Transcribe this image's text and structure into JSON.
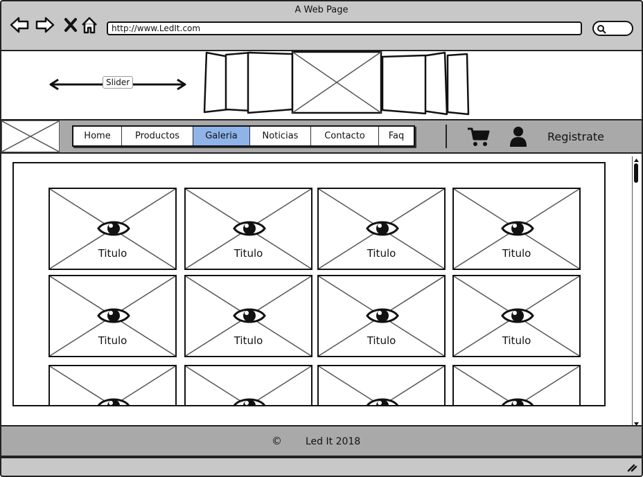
{
  "window": {
    "title": "A Web Page"
  },
  "address_bar": {
    "url": "http://www.LedIt.com"
  },
  "banner": {
    "slider_label": "Slider"
  },
  "nav": {
    "items": [
      {
        "label": "Home",
        "active": false
      },
      {
        "label": "Productos",
        "active": false
      },
      {
        "label": "Galeria",
        "active": true
      },
      {
        "label": "Noticias",
        "active": false
      },
      {
        "label": "Contacto",
        "active": false
      },
      {
        "label": "Faq",
        "active": false
      }
    ],
    "cart_icon": "shopping-cart-icon",
    "user_icon": "user-icon",
    "register_label": "Registrate"
  },
  "gallery": {
    "rows": [
      [
        "Titulo",
        "Titulo",
        "Titulo",
        "Titulo"
      ],
      [
        "Titulo",
        "Titulo",
        "Titulo",
        "Titulo"
      ],
      [
        "",
        "",
        "",
        ""
      ]
    ]
  },
  "footer": {
    "copyright_symbol": "©",
    "text": "Led It 2018"
  },
  "colors": {
    "chrome": "#c8c8c8",
    "bar": "#a9a9a9",
    "active_tab": "#8fb4ea"
  }
}
